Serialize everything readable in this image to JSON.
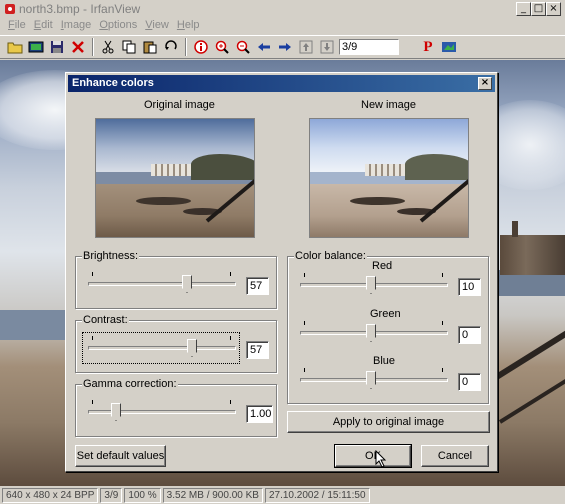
{
  "window": {
    "title": "north3.bmp - IrfanView",
    "controls": [
      "_",
      "□",
      "×"
    ]
  },
  "menu": [
    {
      "label": "File",
      "underline": "F",
      "rest": "ile"
    },
    {
      "label": "Edit",
      "underline": "E",
      "rest": "dit"
    },
    {
      "label": "Image",
      "underline": "I",
      "rest": "mage"
    },
    {
      "label": "Options",
      "underline": "O",
      "rest": "ptions"
    },
    {
      "label": "View",
      "underline": "V",
      "rest": "iew"
    },
    {
      "label": "Help",
      "underline": "H",
      "rest": "elp"
    }
  ],
  "toolbar": {
    "counter": "3/9",
    "p_label": "P"
  },
  "dialog": {
    "title": "Enhance colors",
    "close": "×",
    "original_label": "Original image",
    "new_label": "New image",
    "brightness": {
      "label": "Brightness:",
      "value": "57",
      "fraction": 0.68
    },
    "contrast": {
      "label": "Contrast:",
      "value": "57",
      "fraction": 0.72
    },
    "gamma": {
      "label": "Gamma correction:",
      "value": "1.00",
      "fraction": 0.17
    },
    "color_balance": {
      "label": "Color balance:",
      "red": {
        "label": "Red",
        "value": "10",
        "fraction": 0.48
      },
      "green": {
        "label": "Green",
        "value": "0",
        "fraction": 0.48
      },
      "blue": {
        "label": "Blue",
        "value": "0",
        "fraction": 0.48
      }
    },
    "apply_button": "Apply to original image",
    "default_button": "Set default values",
    "ok_button": "OK",
    "cancel_button": "Cancel"
  },
  "statusbar": [
    "640 x 480 x 24 BPP",
    "3/9",
    "100 %",
    "3.52 MB / 900.00 KB",
    "27.10.2002 / 15:11:50"
  ]
}
